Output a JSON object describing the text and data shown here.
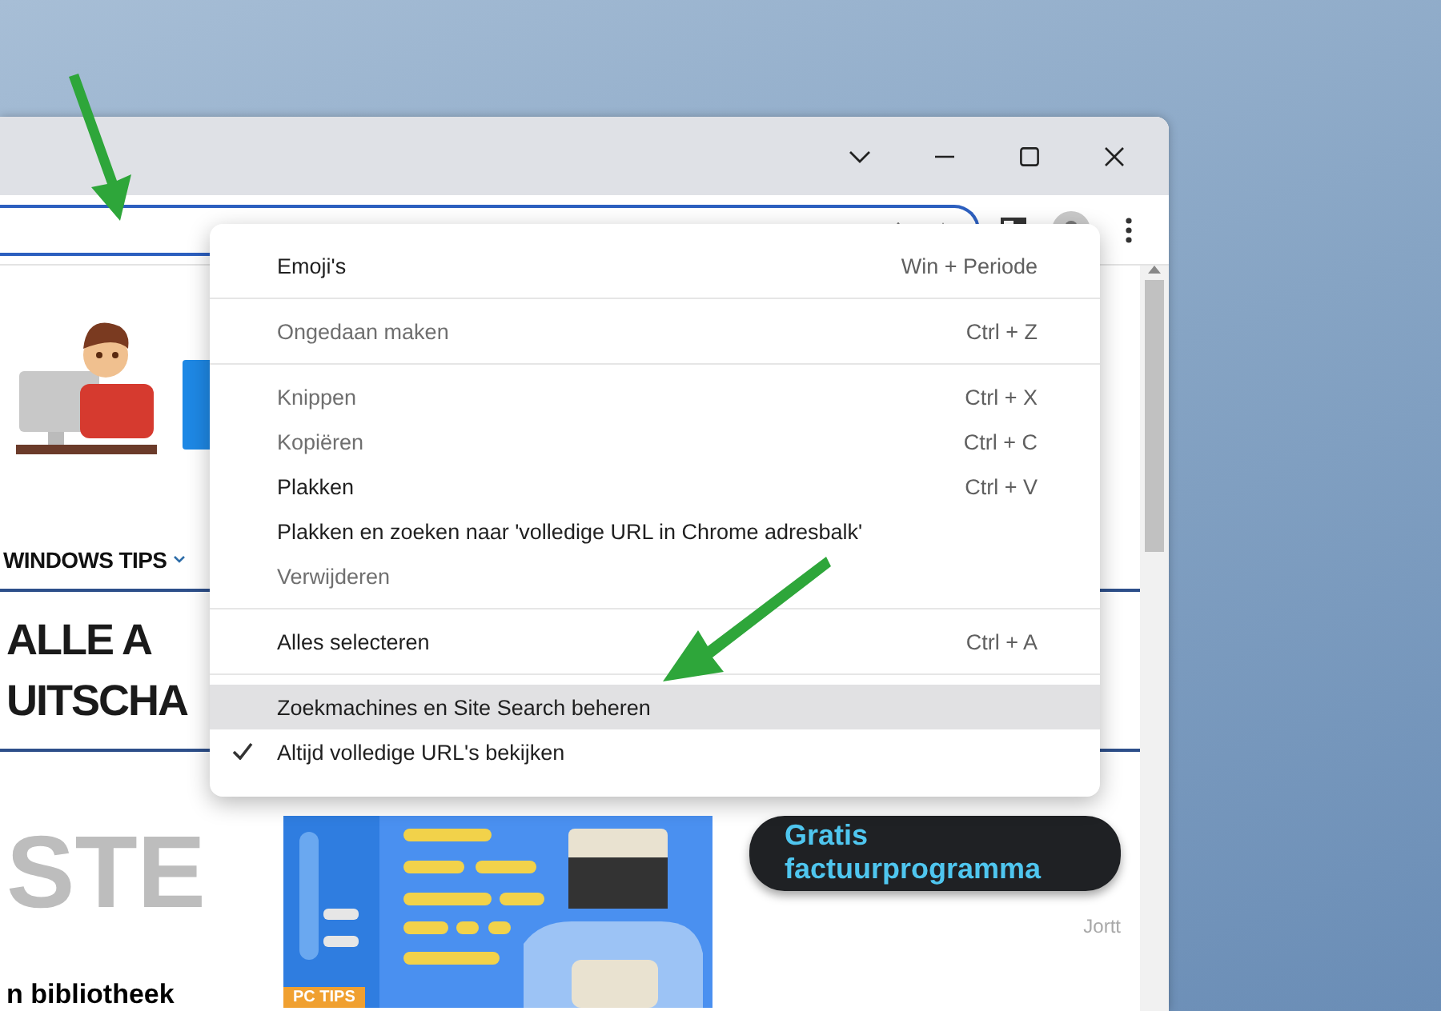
{
  "site": {
    "nav": [
      {
        "label": "WINDOWS TIPS",
        "dropdown": true
      }
    ],
    "headline": [
      "ALLE A",
      "UITSCHA"
    ],
    "faded_title": "STE",
    "article_title": "n bibliotheek",
    "image_tag": "PC TIPS",
    "ad": {
      "text": "Gratis factuurprogramma",
      "source": "Jortt"
    }
  },
  "context_menu": {
    "groups": [
      [
        {
          "label": "Emoji's",
          "shortcut": "Win + Periode",
          "disabled": false,
          "checked": false,
          "highlighted": false
        }
      ],
      [
        {
          "label": "Ongedaan maken",
          "shortcut": "Ctrl + Z",
          "disabled": true,
          "checked": false,
          "highlighted": false
        }
      ],
      [
        {
          "label": "Knippen",
          "shortcut": "Ctrl + X",
          "disabled": true,
          "checked": false,
          "highlighted": false
        },
        {
          "label": "Kopiëren",
          "shortcut": "Ctrl + C",
          "disabled": true,
          "checked": false,
          "highlighted": false
        },
        {
          "label": "Plakken",
          "shortcut": "Ctrl + V",
          "disabled": false,
          "checked": false,
          "highlighted": false
        },
        {
          "label": "Plakken en zoeken naar 'volledige URL in Chrome adresbalk'",
          "disabled": false,
          "checked": false,
          "highlighted": false
        },
        {
          "label": "Verwijderen",
          "disabled": true,
          "checked": false,
          "highlighted": false
        }
      ],
      [
        {
          "label": "Alles selecteren",
          "shortcut": "Ctrl + A",
          "disabled": false,
          "checked": false,
          "highlighted": false
        }
      ],
      [
        {
          "label": "Zoekmachines en Site Search beheren",
          "disabled": false,
          "checked": false,
          "highlighted": true
        },
        {
          "label": "Altijd volledige URL's bekijken",
          "disabled": false,
          "checked": true,
          "highlighted": false
        }
      ]
    ]
  }
}
